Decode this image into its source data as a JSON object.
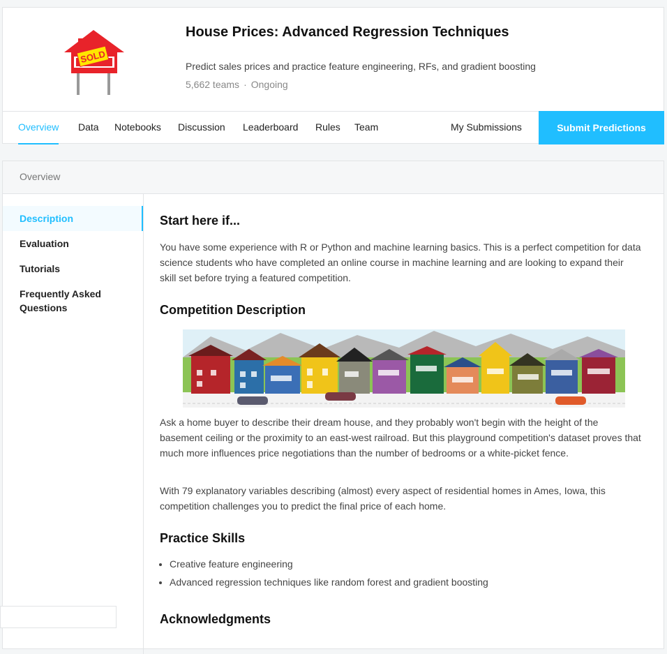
{
  "header": {
    "title": "House Prices: Advanced Regression Techniques",
    "subtitle": "Predict sales prices and practice feature engineering, RFs, and gradient boosting",
    "teams": "5,662 teams",
    "separator": "·",
    "status": "Ongoing",
    "logo_text": "SOLD"
  },
  "nav": {
    "tabs": [
      {
        "label": "Overview"
      },
      {
        "label": "Data"
      },
      {
        "label": "Notebooks"
      },
      {
        "label": "Discussion"
      },
      {
        "label": "Leaderboard"
      },
      {
        "label": "Rules"
      },
      {
        "label": "Team"
      }
    ],
    "my_submissions": "My Submissions",
    "submit": "Submit Predictions"
  },
  "overview": {
    "bar_label": "Overview",
    "sidebar": [
      {
        "label": "Description"
      },
      {
        "label": "Evaluation"
      },
      {
        "label": "Tutorials"
      },
      {
        "label": "Frequently Asked Questions"
      }
    ]
  },
  "content": {
    "h_start": "Start here if...",
    "p_start": "You have some experience with R or Python and machine learning basics. This is a perfect competition for data science students who have completed an online course in machine learning and are looking to expand their skill set before trying a featured competition.",
    "h_desc": "Competition Description",
    "p_desc1": "Ask a home buyer to describe their dream house, and they probably won't begin with the height of the basement ceiling or the proximity to an east-west railroad. But this playground competition's dataset proves that much more influences price negotiations than the number of bedrooms or a white-picket fence.",
    "p_desc2": "With 79 explanatory variables describing (almost) every aspect of residential homes in Ames, Iowa, this competition challenges you to predict the final price of each home.",
    "h_skills": "Practice Skills",
    "skills": [
      "Creative feature engineering",
      "Advanced regression techniques like random forest and gradient boosting"
    ],
    "h_ack": "Acknowledgments"
  },
  "colors": {
    "accent": "#20beff",
    "title": "#111111",
    "body": "#444444",
    "muted": "#888888"
  }
}
